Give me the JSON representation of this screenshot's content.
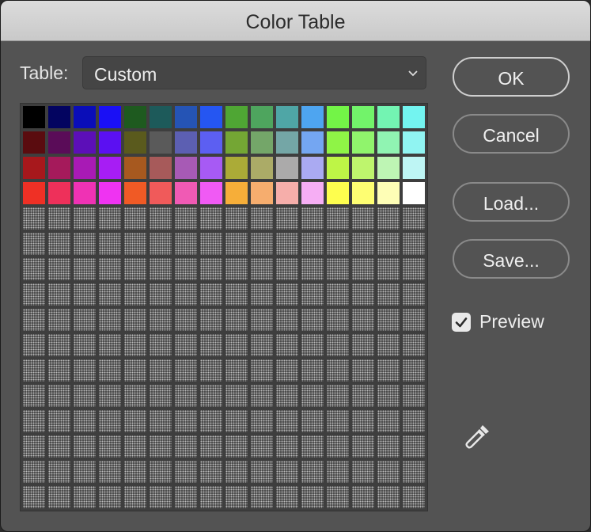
{
  "window": {
    "title": "Color Table"
  },
  "table": {
    "label": "Table:",
    "value": "Custom"
  },
  "buttons": {
    "ok": "OK",
    "cancel": "Cancel",
    "load": "Load...",
    "save": "Save..."
  },
  "preview": {
    "label": "Preview",
    "checked": true
  },
  "icons": {
    "dropdown": "chevron-down-icon",
    "checkbox": "checkmark-icon",
    "picker": "eyedropper-icon"
  },
  "swatches": {
    "columns": 16,
    "total_slots": 256,
    "colors": [
      "#000000",
      "#030460",
      "#0a0db8",
      "#1a10f5",
      "#1e5a1f",
      "#1d5a5a",
      "#2554b5",
      "#2556f2",
      "#4fa634",
      "#4ea55e",
      "#4fa6a6",
      "#4ea5f0",
      "#73f447",
      "#72f36a",
      "#73f4b2",
      "#73f4f0",
      "#5a0c0f",
      "#5a0c58",
      "#5c0fb8",
      "#5b10f2",
      "#5a5a1d",
      "#5a5a5a",
      "#5c5fb2",
      "#5c5ff2",
      "#74a634",
      "#74a669",
      "#74a6a6",
      "#74a6f2",
      "#8ff446",
      "#90f46c",
      "#90f4b2",
      "#90f4f2",
      "#a7181c",
      "#a51a5b",
      "#a81ab5",
      "#a71df4",
      "#a7591f",
      "#a75a5a",
      "#a75ab5",
      "#a75af4",
      "#abab37",
      "#abab67",
      "#abaaaa",
      "#aaaaf2",
      "#bef546",
      "#bef56d",
      "#bef5b4",
      "#bef5f4",
      "#ef3025",
      "#ee305a",
      "#ef32b4",
      "#ef33f2",
      "#f05a25",
      "#f05a5a",
      "#f05ab4",
      "#f05af4",
      "#f6ae39",
      "#f6ad6e",
      "#f6aeaa",
      "#f6aef4",
      "#fefe4e",
      "#fefe72",
      "#fefeb6",
      "#ffffff"
    ]
  }
}
